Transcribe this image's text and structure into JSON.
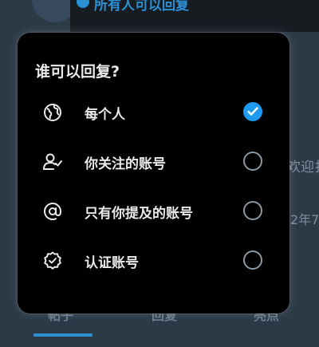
{
  "background": {
    "reply_setting_text": "所有人可以回复",
    "side_text_1": "欢迎扌",
    "side_text_2": "2年7",
    "tabs": [
      "帖子",
      "回复",
      "亮点"
    ]
  },
  "popup": {
    "title": "谁可以回复?",
    "options": [
      {
        "label": "每个人",
        "icon": "globe-icon",
        "selected": true
      },
      {
        "label": "你关注的账号",
        "icon": "person-check-icon",
        "selected": false
      },
      {
        "label": "只有你提及的账号",
        "icon": "at-sign-icon",
        "selected": false
      },
      {
        "label": "认证账号",
        "icon": "verified-badge-icon",
        "selected": false
      }
    ]
  },
  "colors": {
    "accent": "#1d9bf0",
    "popup_bg": "#000000",
    "text": "#e7e9ea",
    "radio_border": "#8b98a5"
  }
}
